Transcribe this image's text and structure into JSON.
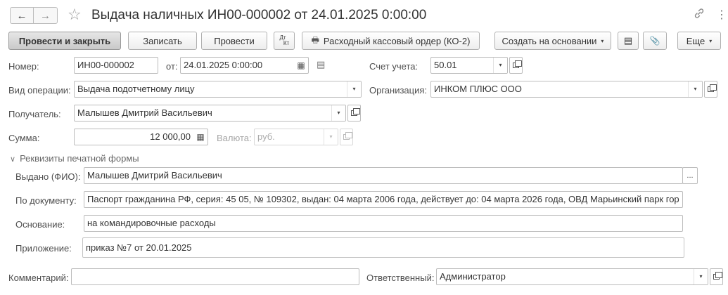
{
  "window": {
    "title": "Выдача наличных ИН00-000002 от 24.01.2025 0:00:00",
    "back_icon": "←",
    "forward_icon": "→",
    "star_icon": "☆",
    "link_icon": "🔗",
    "menu_icon": "⋮",
    "close_icon": "✕"
  },
  "toolbar": {
    "post_close": "Провести и закрыть",
    "write": "Записать",
    "post": "Провести",
    "dt_kt_top": "Дт",
    "dt_kt_bottom": "Кт",
    "print_icon": "🖶",
    "print_label": "Расходный кассовый ордер (КО-2)",
    "create_based": "Создать на основании",
    "structure_icon": "▤",
    "attach_icon": "📎",
    "more": "Еще",
    "dropdown_arrow": "▾"
  },
  "form": {
    "number_label": "Номер:",
    "number_value": "ИН00-000002",
    "date_label": "от:",
    "date_value": "24.01.2025  0:00:00",
    "account_label": "Счет учета:",
    "account_value": "50.01",
    "operation_label": "Вид операции:",
    "operation_value": "Выдача подотчетному лицу",
    "organization_label": "Организация:",
    "organization_value": "ИНКОМ ПЛЮС ООО",
    "recipient_label": "Получатель:",
    "recipient_value": "Малышев Дмитрий Васильевич",
    "amount_label": "Сумма:",
    "amount_value": "12 000,00",
    "currency_label": "Валюта:",
    "currency_value": "руб.",
    "calendar_icon": "▦",
    "calculator_icon": "▦",
    "history_icon": "▤"
  },
  "print_section": {
    "header": "Реквизиты печатной формы",
    "chevron": "∨",
    "issued_label": "Выдано (ФИО):",
    "issued_value": "Малышев Дмитрий Васильевич",
    "issued_button": "...",
    "document_label": "По документу:",
    "document_value": "Паспорт гражданина РФ, серия: 45 05, № 109302, выдан: 04 марта 2006 года, действует до: 04 марта 2026 года, ОВД Марьинский парк гор",
    "basis_label": "Основание:",
    "basis_value": "на командировочные расходы",
    "attachment_label": "Приложение:",
    "attachment_value": "приказ №7 от 20.01.2025"
  },
  "footer": {
    "comment_label": "Комментарий:",
    "comment_value": "",
    "responsible_label": "Ответственный:",
    "responsible_value": "Администратор"
  }
}
